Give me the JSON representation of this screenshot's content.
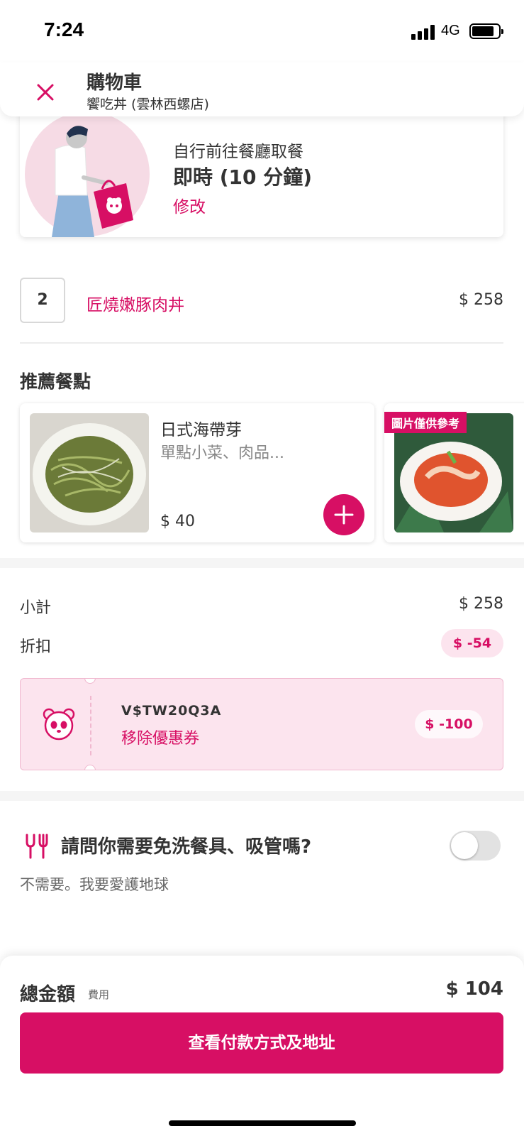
{
  "status_bar": {
    "time": "7:24",
    "network": "4G"
  },
  "header": {
    "title": "購物車",
    "subtitle": "饗吃丼 (雲林西螺店)",
    "close_icon": "close-icon"
  },
  "pickup": {
    "label": "自行前往餐廳取餐",
    "time": "即時 (10 分鐘)",
    "edit": "修改"
  },
  "cart": {
    "items": [
      {
        "quantity": "2",
        "name": "匠燒嫩豚肉丼",
        "price": "$ 258"
      }
    ]
  },
  "recommended": {
    "title": "推薦餐點",
    "items": [
      {
        "name": "日式海帶芽",
        "description": "單點小菜、肉品...",
        "price": "$ 40"
      },
      {
        "tag": "圖片僅供參考"
      }
    ]
  },
  "summary": {
    "subtotal_label": "小計",
    "subtotal_value": "$ 258",
    "discount_label": "折扣",
    "discount_value": "$ -54"
  },
  "voucher": {
    "code": "V$TW20Q3A",
    "remove_label": "移除優惠券",
    "amount": "$ -100"
  },
  "cutlery": {
    "question": "請問你需要免洗餐具、吸管嗎?",
    "answer": "不需要。我要愛護地球",
    "enabled": false
  },
  "footer": {
    "total_label": "總金額",
    "fee_label": "費用",
    "total_value": "$ 104",
    "checkout_label": "查看付款方式及地址"
  },
  "colors": {
    "brand": "#d70f64",
    "brand_light": "#fce4ee"
  }
}
